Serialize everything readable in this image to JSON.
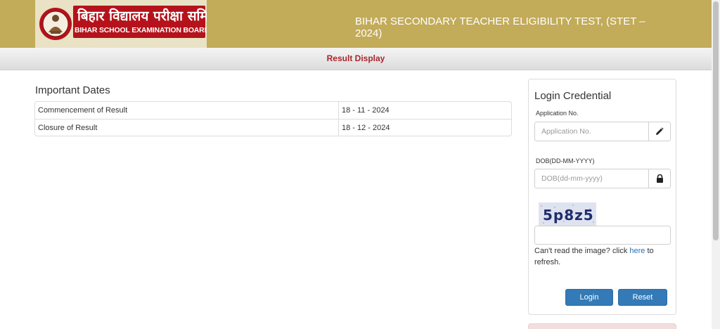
{
  "header": {
    "logo_hindi": "बिहार विद्यालय परीक्षा समिति",
    "logo_english": "BIHAR SCHOOL EXAMINATION BOARD",
    "title": "BIHAR SECONDARY TEACHER ELIGIBILITY TEST, (STET – 2024)"
  },
  "subbar": {
    "title": "Result Display"
  },
  "dates": {
    "title": "Important Dates",
    "rows": [
      {
        "label": "Commencement of Result",
        "value": "18 - 11 - 2024"
      },
      {
        "label": "Closure of Result",
        "value": "18 - 12 - 2024"
      }
    ]
  },
  "login": {
    "title": "Login Credential",
    "app_label": "Application No.",
    "app_placeholder": "Application No.",
    "app_value": "",
    "dob_label": "DOB(DD-MM-YYYY)",
    "dob_placeholder": "DOB(dd-mm-yyyy)",
    "dob_value": "",
    "captcha_text": "5p8z5",
    "captcha_value": "",
    "refresh_prefix": "Can't read the image? click ",
    "refresh_link": "here",
    "refresh_suffix": " to refresh.",
    "login_button": "Login",
    "reset_button": "Reset"
  },
  "icons": {
    "app_field": "pencil-icon",
    "dob_field": "lock-icon"
  },
  "colors": {
    "header_bg": "#c2ab59",
    "logo_band": "#b5121b",
    "subbar_title": "#a8262b",
    "button": "#337ab7",
    "link": "#2a6fb5"
  }
}
